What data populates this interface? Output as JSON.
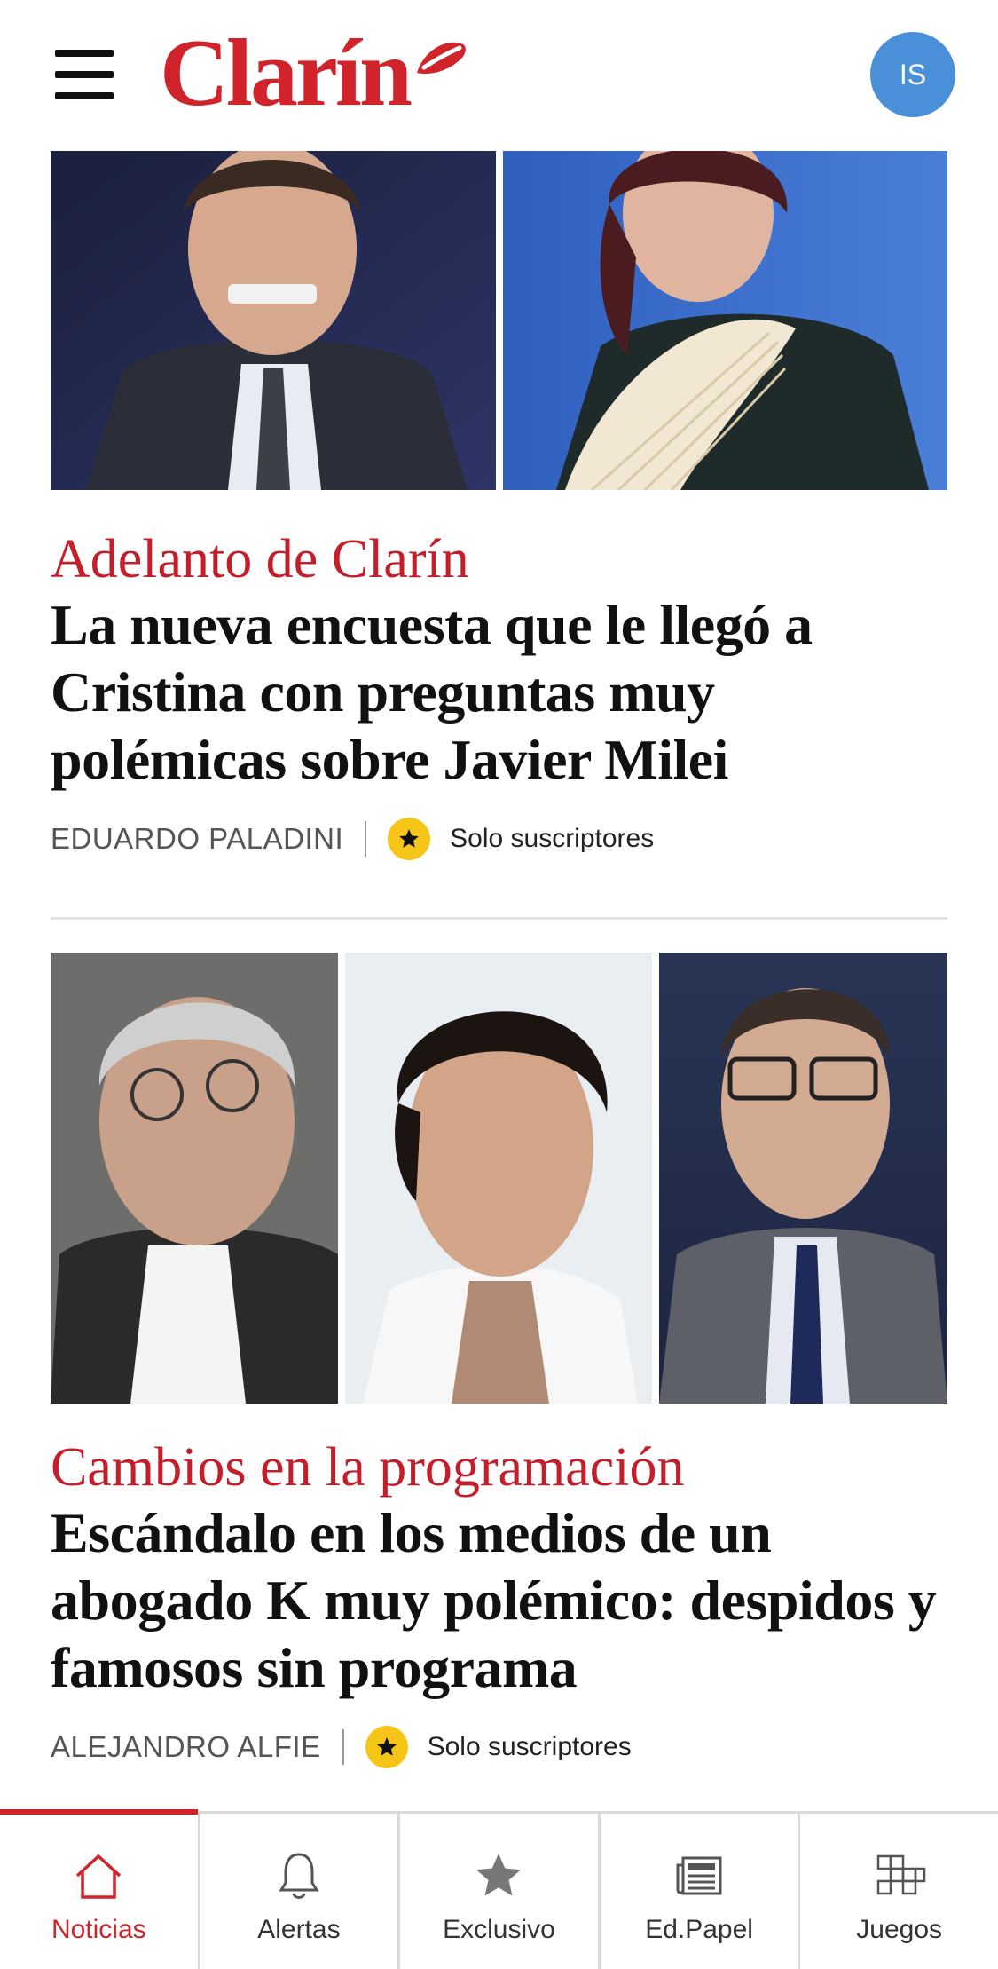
{
  "header": {
    "logo_text": "Clarín",
    "avatar_initials": "IS"
  },
  "articles": [
    {
      "kicker": "Adelanto de Clarín",
      "headline": "La nueva encuesta que le llegó a Cristina con preguntas muy polémicas sobre Javier Milei",
      "author": "EDUARDO PALADINI",
      "badge": "Solo suscriptores"
    },
    {
      "kicker": "Cambios en la programación",
      "headline": "Escándalo en los medios de un abogado K muy polémico: despidos y famosos sin programa",
      "author": "ALEJANDRO ALFIE",
      "badge": "Solo suscriptores"
    }
  ],
  "bottom_nav": {
    "items": [
      {
        "label": "Noticias",
        "icon": "house-icon",
        "active": true
      },
      {
        "label": "Alertas",
        "icon": "bell-icon",
        "active": false
      },
      {
        "label": "Exclusivo",
        "icon": "star-icon",
        "active": false
      },
      {
        "label": "Ed.Papel",
        "icon": "newspaper-icon",
        "active": false
      },
      {
        "label": "Juegos",
        "icon": "crossword-icon",
        "active": false
      }
    ]
  },
  "colors": {
    "brand_red": "#d0232a",
    "kicker_red": "#c41e2a",
    "avatar_blue": "#4a90d9",
    "badge_yellow": "#f5c518"
  }
}
